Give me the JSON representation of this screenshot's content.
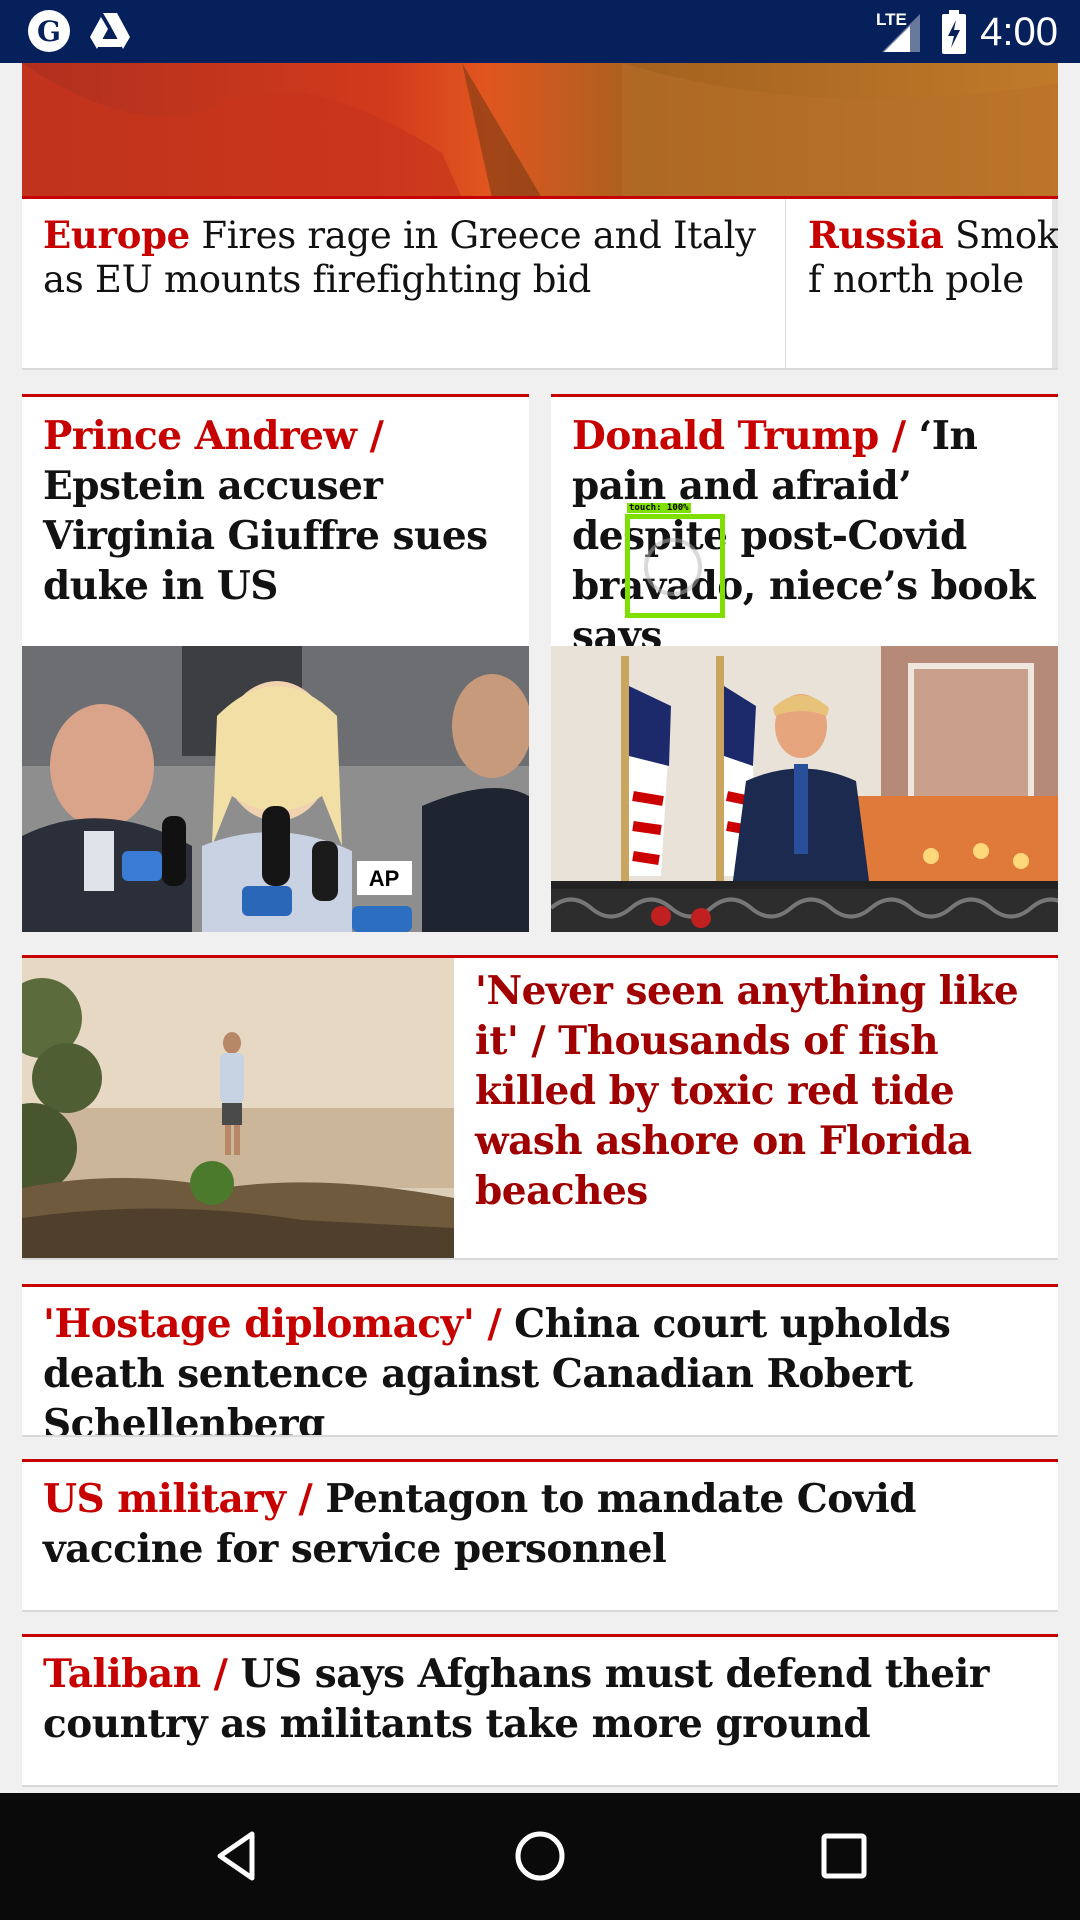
{
  "status_bar": {
    "time": "4:00",
    "network": "LTE",
    "icons": [
      "guardian-logo-icon",
      "drive-icon",
      "signal-icon",
      "battery-charging-icon"
    ]
  },
  "top_strip": {
    "card_left": {
      "kicker": "Europe",
      "text": "Fires rage in Greece and Italy as EU mounts firefighting bid"
    },
    "card_right": {
      "kicker": "Russia",
      "text": "Smoke f north pole"
    }
  },
  "grid": [
    {
      "kicker": "Prince Andrew /",
      "text": "Epstein accuser Virginia Giuffre sues duke in US"
    },
    {
      "kicker": "Donald Trump /",
      "text": "‘In pain and afraid’ despite post-Covid bravado, niece’s book says"
    }
  ],
  "feature": {
    "kicker": "'Never seen anything like it' /",
    "text": "Thousands of fish killed by toxic red tide wash ashore on Florida beaches"
  },
  "list": [
    {
      "kicker": "'Hostage diplomacy' /",
      "text": "China court upholds death sentence against Canadian Robert Schellenberg"
    },
    {
      "kicker": "US military /",
      "text": "Pentagon to mandate Covid vaccine for service personnel"
    },
    {
      "kicker": "Taliban /",
      "text": "US says Afghans must defend their country as militants take more ground"
    }
  ],
  "touch_overlay": {
    "label": "touch: 100%"
  },
  "nav_bar": {
    "icons": [
      "back-icon",
      "home-icon",
      "recents-icon"
    ]
  },
  "colors": {
    "accent": "#c70000",
    "status_bar": "#05205b",
    "nav_bar": "#0a0a0a"
  }
}
